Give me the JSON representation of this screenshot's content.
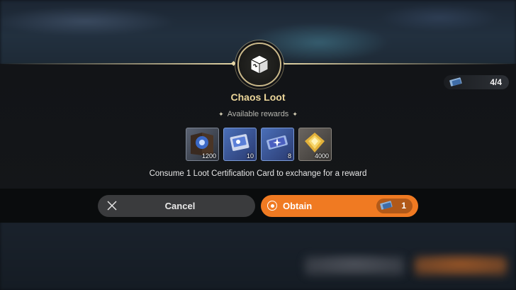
{
  "dialog": {
    "title": "Chaos Loot",
    "subtitle": "Available rewards",
    "description": "Consume 1 Loot Certification Card to exchange for a reward",
    "emblem_icon": "loot-box-icon"
  },
  "counter": {
    "icon": "certification-card-icon",
    "value": "4/4"
  },
  "rewards": [
    {
      "name": "blue-book-item",
      "quantity": "1200",
      "color": "#3b6fd8"
    },
    {
      "name": "blue-card-item",
      "quantity": "10",
      "color": "#5b7fd8"
    },
    {
      "name": "blue-ticket-item",
      "quantity": "8",
      "color": "#5b6fd0"
    },
    {
      "name": "gold-gem-item",
      "quantity": "4000",
      "color": "#e2b13a"
    }
  ],
  "actions": {
    "cancel_label": "Cancel",
    "obtain_label": "Obtain",
    "obtain_cost": "1",
    "obtain_cost_icon": "certification-card-icon"
  },
  "colors": {
    "accent_orange": "#f07a22",
    "title_gold": "#ecd69a",
    "cancel_gray": "#3a3b3d"
  }
}
